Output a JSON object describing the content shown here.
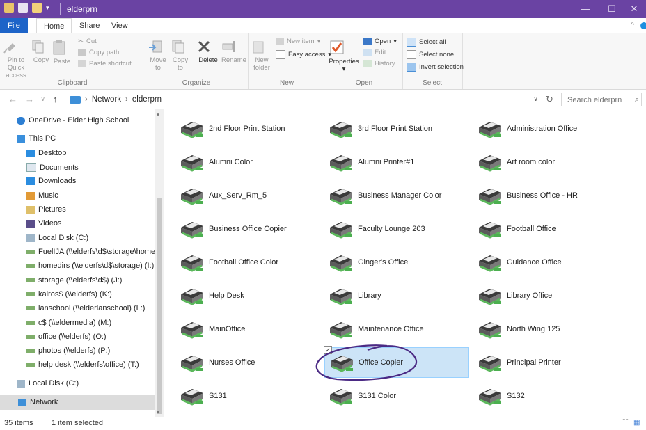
{
  "window": {
    "title": "elderprn",
    "controls": {
      "minimize": "—",
      "maximize": "☐",
      "close": "✕"
    }
  },
  "ribbon_tabs": [
    "File",
    "Home",
    "Share",
    "View"
  ],
  "ribbon": {
    "clipboard": {
      "pin": "Pin to Quick access",
      "copy": "Copy",
      "paste": "Paste",
      "cut": "Cut",
      "copy_path": "Copy path",
      "paste_shortcut": "Paste shortcut",
      "label": "Clipboard"
    },
    "organize": {
      "move_to": "Move to",
      "copy_to": "Copy to",
      "delete": "Delete",
      "rename": "Rename",
      "label": "Organize"
    },
    "new": {
      "new_folder": "New folder",
      "new_item": "New item",
      "easy_access": "Easy access",
      "label": "New"
    },
    "open": {
      "properties": "Properties",
      "open": "Open",
      "edit": "Edit",
      "history": "History",
      "label": "Open"
    },
    "select": {
      "select_all": "Select all",
      "select_none": "Select none",
      "invert_selection": "Invert selection",
      "label": "Select"
    }
  },
  "address": {
    "path": [
      "Network",
      "elderprn"
    ],
    "search_placeholder": "Search elderprn"
  },
  "sidebar": {
    "items": [
      {
        "label": "OneDrive - Elder High School",
        "icon": "cloud-icon"
      },
      {
        "label": "This PC",
        "icon": "pc-icon"
      },
      {
        "label": "Desktop",
        "icon": "folder-icon"
      },
      {
        "label": "Documents",
        "icon": "documents-icon"
      },
      {
        "label": "Downloads",
        "icon": "downloads-icon"
      },
      {
        "label": "Music",
        "icon": "music-icon"
      },
      {
        "label": "Pictures",
        "icon": "pictures-icon"
      },
      {
        "label": "Videos",
        "icon": "videos-icon"
      },
      {
        "label": "Local Disk (C:)",
        "icon": "disk-icon"
      },
      {
        "label": "FuelIJA (\\\\elderfs\\d$\\storage\\homedir",
        "icon": "network-drive-icon"
      },
      {
        "label": "homedirs (\\\\elderfs\\d$\\storage) (I:)",
        "icon": "network-drive-icon"
      },
      {
        "label": "storage (\\\\elderfs\\d$) (J:)",
        "icon": "network-drive-icon"
      },
      {
        "label": "kairos$ (\\\\elderfs) (K:)",
        "icon": "network-drive-icon"
      },
      {
        "label": "lanschool (\\\\elderlanschool) (L:)",
        "icon": "network-drive-icon"
      },
      {
        "label": "c$ (\\\\eldermedia) (M:)",
        "icon": "network-drive-icon"
      },
      {
        "label": "office (\\\\elderfs) (O:)",
        "icon": "network-drive-icon"
      },
      {
        "label": "photos (\\\\elderfs) (P:)",
        "icon": "network-drive-icon"
      },
      {
        "label": "help desk (\\\\elderfs\\office) (T:)",
        "icon": "network-drive-icon"
      },
      {
        "label": "Local Disk (C:)",
        "icon": "disk-icon"
      },
      {
        "label": "Network",
        "icon": "network-icon"
      }
    ]
  },
  "printers": [
    "2nd Floor Print Station",
    "3rd Floor Print Station",
    "Administration Office",
    "Alumni Color",
    "Alumni Printer#1",
    "Art room color",
    "Aux_Serv_Rm_5",
    "Business Manager Color",
    "Business Office - HR",
    "Business Office Copier",
    "Faculty Lounge 203",
    "Football Office",
    "Football Office Color",
    "Ginger's Office",
    "Guidance Office",
    "Help Desk",
    "Library",
    "Library Office",
    "MainOffice",
    "Maintenance Office",
    "North Wing 125",
    "Nurses Office",
    "Office Copier",
    "Principal Printer",
    "S131",
    "S131 Color",
    "S132"
  ],
  "selected_printer": "Office Copier",
  "status": {
    "count": "35 items",
    "selection": "1 item selected"
  },
  "colors": {
    "titlebar": "#6a43a3",
    "accent": "#1e64c8",
    "selection": "#cce4f7",
    "annotation": "#4b2a84"
  }
}
